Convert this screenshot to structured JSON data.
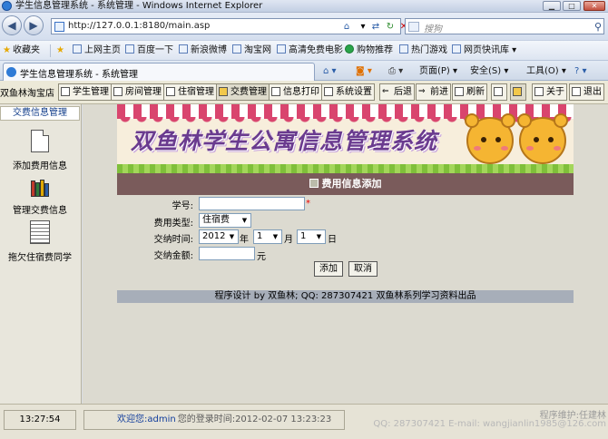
{
  "window": {
    "title": "学生信息管理系统 - 系统管理 - Windows Internet Explorer"
  },
  "browser": {
    "address": "http://127.0.0.1:8180/main.asp",
    "search_placeholder": "搜狗",
    "tab_title": "学生信息管理系统 - 系统管理",
    "favorites_label": "收藏夹",
    "favorites": [
      "上网主页",
      "百度一下",
      "新浪微博",
      "淘宝网",
      "高清免费电影",
      "购物推荐",
      "热门游戏",
      "网页快讯库"
    ],
    "commands": {
      "page": "页面(P)",
      "safety": "安全(S)",
      "tools": "工具(O)",
      "help": "?"
    }
  },
  "toolbar": {
    "brand": "双鱼林淘宝店",
    "buttons": [
      "学生管理",
      "房间管理",
      "住宿管理",
      "交费管理",
      "信息打印",
      "系统设置",
      "后退",
      "前进",
      "刷新"
    ],
    "about": "关于",
    "exit": "退出"
  },
  "sidebar": {
    "header": "交费信息管理",
    "items": [
      {
        "label": "添加费用信息",
        "icon": "document-icon"
      },
      {
        "label": "管理交费信息",
        "icon": "books-icon"
      },
      {
        "label": "拖欠住宿费同学",
        "icon": "list-icon"
      }
    ]
  },
  "banner": {
    "title": "双鱼林学生公寓信息管理系统"
  },
  "form": {
    "header": "费用信息添加",
    "student_id_label": "学号:",
    "student_id_value": "",
    "required_mark": "*",
    "fee_type_label": "费用类型:",
    "fee_type_value": "住宿费",
    "date_label": "交纳时间:",
    "year_value": "2012",
    "year_unit": "年",
    "month_value": "1",
    "month_unit": "月",
    "day_value": "1",
    "day_unit": "日",
    "amount_label": "交纳金额:",
    "amount_value": "",
    "amount_unit": "元",
    "submit_label": "添加",
    "cancel_label": "取消"
  },
  "footer": {
    "credit": "程序设计  by 双鱼林; QQ: 287307421 双鱼林系列学习资料出品"
  },
  "status": {
    "clock": "13:27:54",
    "welcome": "欢迎您:admin",
    "last_login": "您的登录时间:2012-02-07 13:23:23",
    "maintainer": "程序维护:任建林",
    "contact": "QQ: 287307421 E-mail: wangjianlin1985@126.com"
  },
  "colors": {
    "form_header": "#7a5b5b",
    "footer_bar": "#a7aeb9",
    "banner_title": "#6a3b8f"
  }
}
